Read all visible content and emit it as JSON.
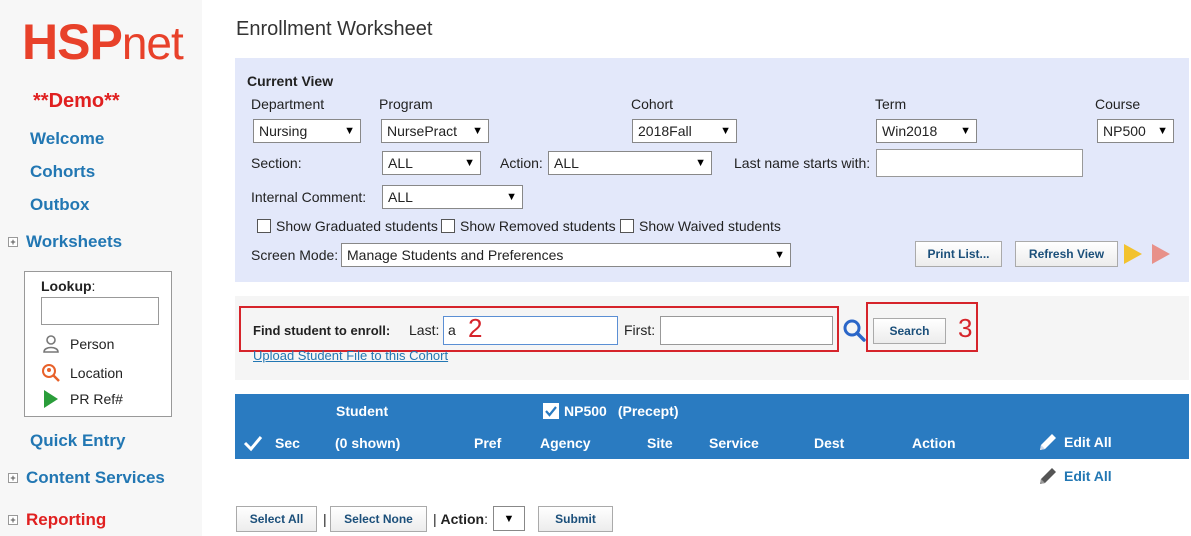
{
  "logo": {
    "part1": "HSP",
    "part2": "net"
  },
  "demo_label": "**Demo**",
  "sidebar": {
    "welcome": "Welcome",
    "cohorts": "Cohorts",
    "outbox": "Outbox",
    "worksheets": "Worksheets",
    "quick_entry": "Quick Entry",
    "content_services": "Content Services",
    "reporting": "Reporting",
    "lookup": {
      "label": "Lookup",
      "colon": ":",
      "input_value": "",
      "person": "Person",
      "location": "Location",
      "pr_ref": "PR Ref#"
    }
  },
  "page_title": "Enrollment Worksheet",
  "current_view": {
    "heading": "Current View",
    "department_label": "Department",
    "department_value": "Nursing",
    "program_label": "Program",
    "program_value": "NursePract",
    "cohort_label": "Cohort",
    "cohort_value": "2018Fall",
    "term_label": "Term",
    "term_value": "Win2018",
    "course_label": "Course",
    "course_value": "NP500",
    "section_label": "Section:",
    "section_value": "ALL",
    "action_label": "Action:",
    "action_value": "ALL",
    "lastname_label": "Last name starts with:",
    "lastname_value": "",
    "internal_comment_label": "Internal Comment:",
    "internal_comment_value": "ALL",
    "show_graduated": "Show Graduated students",
    "show_removed": "Show Removed students",
    "show_waived": "Show Waived students",
    "screen_mode_label": "Screen Mode:",
    "screen_mode_value": "Manage Students and Preferences",
    "print_list": "Print List...",
    "refresh_view": "Refresh View"
  },
  "find": {
    "label": "Find student to enroll:",
    "last_label": "Last:",
    "last_value": "a",
    "first_label": "First:",
    "first_value": "",
    "search_button": "Search",
    "upload_link": "Upload Student File to this Cohort",
    "annot_2": "2",
    "annot_3": "3"
  },
  "table": {
    "student": "Student",
    "course_check": "NP500",
    "precept": "(Precept)",
    "sec": "Sec",
    "shown": "(0 shown)",
    "pref": "Pref",
    "agency": "Agency",
    "site": "Site",
    "service": "Service",
    "dest": "Dest",
    "action": "Action",
    "edit_all": "Edit All",
    "edit_all_2": "Edit All"
  },
  "bottom": {
    "select_all": "Select All",
    "select_none": "Select None",
    "sep": "|",
    "sep2": "|",
    "action_label": "Action",
    "action_colon": ":",
    "submit": "Submit"
  },
  "colors": {
    "accent_red": "#d6242b",
    "link_blue": "#2277b3",
    "header_blue": "#2a7bc1",
    "panel_lavender": "#e3e8fa"
  }
}
